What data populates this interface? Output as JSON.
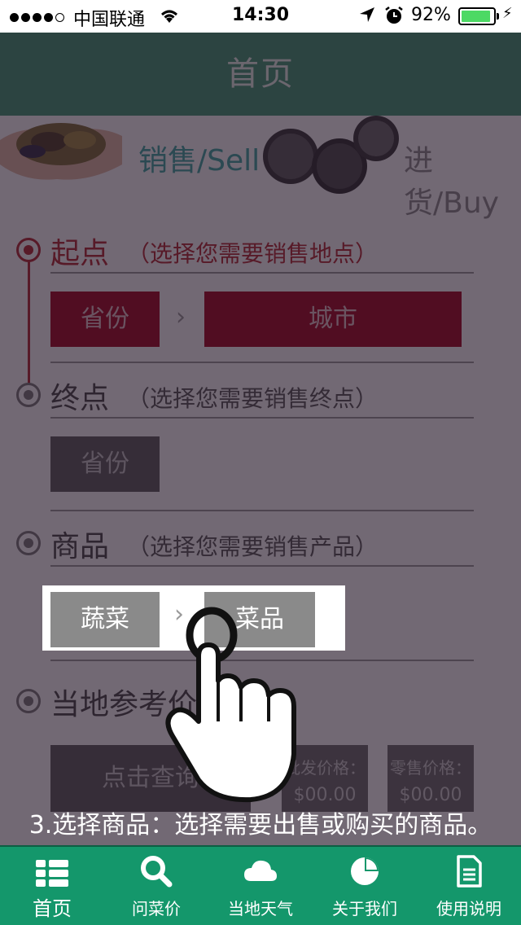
{
  "status_bar": {
    "carrier": "中国联通",
    "time": "14:30",
    "battery": "92%",
    "battery_level": 0.92
  },
  "header": {
    "title": "首页"
  },
  "banner": {
    "sell_label": "销售/Sell",
    "buy_label": "进货/Buy"
  },
  "sections": {
    "start": {
      "title": "起点",
      "hint": "（选择您需要销售地点）",
      "province_button": "省份",
      "city_button": "城市"
    },
    "end": {
      "title": "终点",
      "hint": "（选择您需要销售终点）",
      "province_button": "省份"
    },
    "goods": {
      "title": "商品",
      "hint": "（选择您需要销售产品）",
      "category_button": "蔬菜",
      "product_button": "菜品"
    },
    "price": {
      "title": "当地参考价格",
      "query_button": "点击查询",
      "wholesale_label": "批发价格：",
      "wholesale_value": "$00.00",
      "retail_label": "零售价格：",
      "retail_value": "$00.00"
    }
  },
  "tutorial": {
    "caption": "3.选择商品：选择需要出售或购买的商品。"
  },
  "tabs": [
    {
      "label": "首页",
      "icon": "list-icon",
      "active": true
    },
    {
      "label": "问菜价",
      "icon": "search-icon",
      "active": false
    },
    {
      "label": "当地天气",
      "icon": "cloud-icon",
      "active": false
    },
    {
      "label": "关于我们",
      "icon": "pie-chart-icon",
      "active": false
    },
    {
      "label": "使用说明",
      "icon": "document-icon",
      "active": false
    }
  ],
  "colors": {
    "accent_green": "#14976b",
    "header_green": "#3e9a72",
    "brand_red": "#a3001d"
  }
}
